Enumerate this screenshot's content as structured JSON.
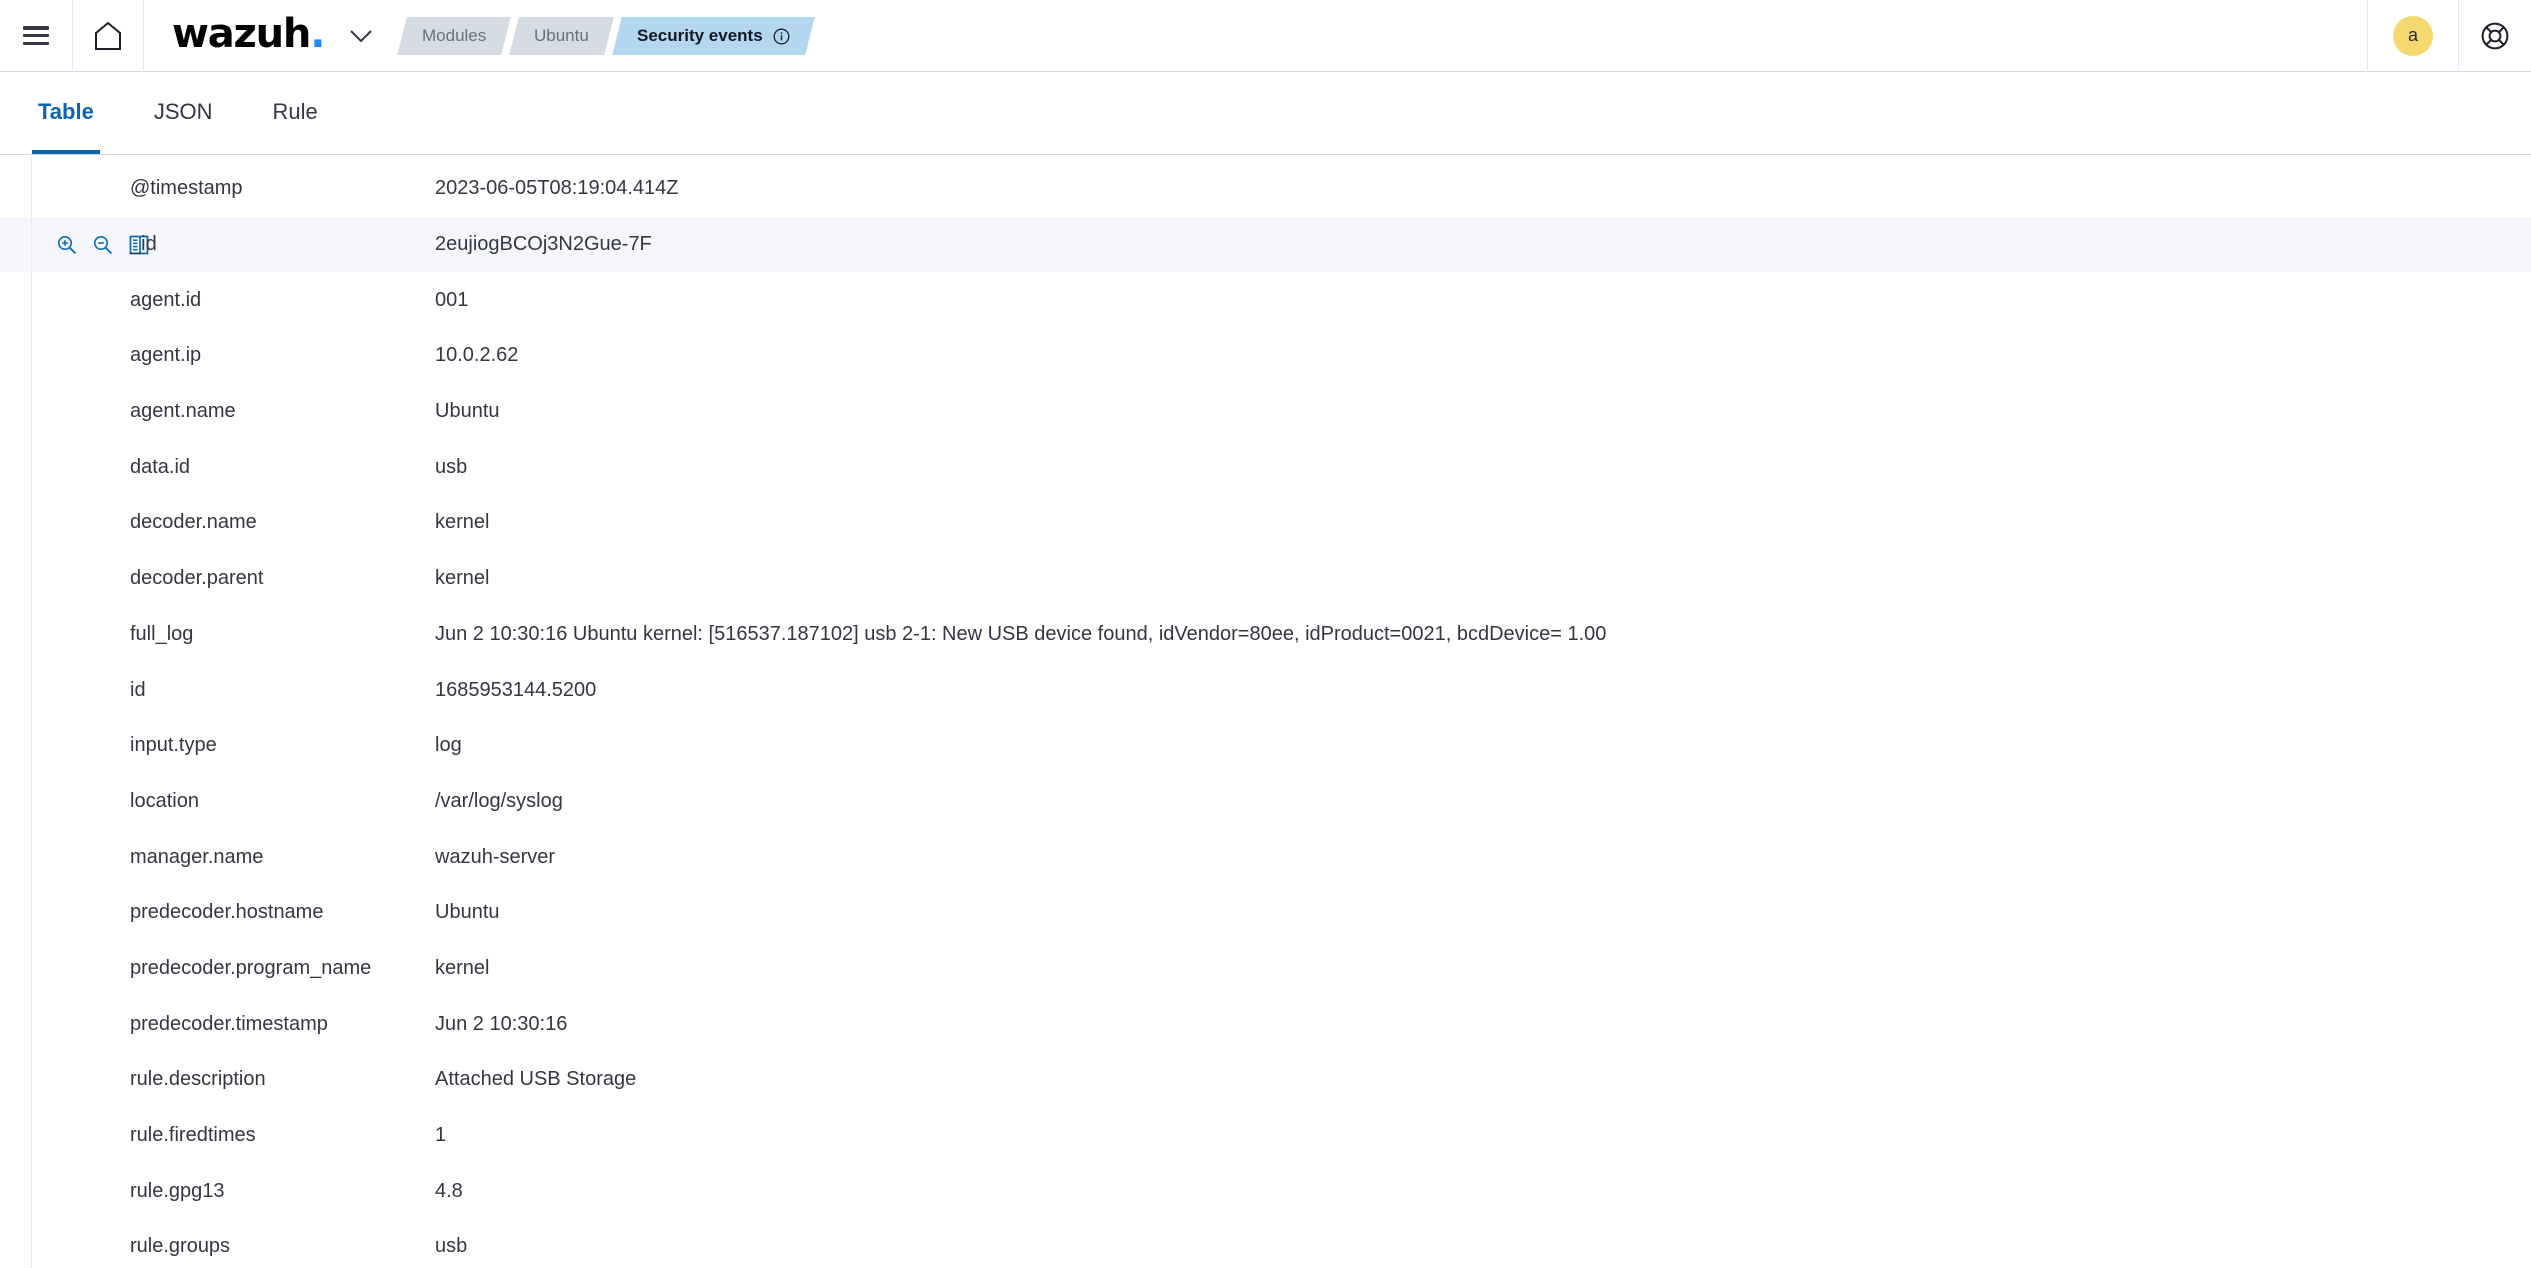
{
  "header": {
    "menu_icon": "hamburger-menu-icon",
    "home_icon": "home-icon",
    "brand_name": "wazuh",
    "brand_dot": ".",
    "brand_dot_color": "#1f8bff",
    "chevron_icon": "chevron-down-icon",
    "breadcrumbs": [
      {
        "label": "Modules",
        "active": false
      },
      {
        "label": "Ubuntu",
        "active": false
      },
      {
        "label": "Security events",
        "active": true,
        "info_icon": "info-circle-icon"
      }
    ],
    "avatar_initial": "a",
    "avatar_color": "#f5d86e",
    "help_icon": "help-lifebuoy-icon"
  },
  "tabs": [
    {
      "label": "Table",
      "active": true
    },
    {
      "label": "JSON",
      "active": false
    },
    {
      "label": "Rule",
      "active": false
    }
  ],
  "accent_color": "#0b64b0",
  "row_actions": {
    "filter_for_value_icon": "magnifier-plus-icon",
    "filter_out_value_icon": "magnifier-minus-icon",
    "toggle_column_icon": "table-column-icon"
  },
  "document_fields": [
    {
      "name": "@timestamp",
      "value": "2023-06-05T08:19:04.414Z",
      "hovered": false
    },
    {
      "name": "_id",
      "value": "2eujiogBCOj3N2Gue-7F",
      "hovered": true
    },
    {
      "name": "agent.id",
      "value": "001",
      "hovered": false
    },
    {
      "name": "agent.ip",
      "value": "10.0.2.62",
      "hovered": false
    },
    {
      "name": "agent.name",
      "value": "Ubuntu",
      "hovered": false
    },
    {
      "name": "data.id",
      "value": "usb",
      "hovered": false
    },
    {
      "name": "decoder.name",
      "value": "kernel",
      "hovered": false
    },
    {
      "name": "decoder.parent",
      "value": "kernel",
      "hovered": false
    },
    {
      "name": "full_log",
      "value": "Jun  2 10:30:16 Ubuntu kernel: [516537.187102] usb 2-1: New USB device found, idVendor=80ee, idProduct=0021, bcdDevice= 1.00",
      "hovered": false
    },
    {
      "name": "id",
      "value": "1685953144.5200",
      "hovered": false
    },
    {
      "name": "input.type",
      "value": "log",
      "hovered": false
    },
    {
      "name": "location",
      "value": "/var/log/syslog",
      "hovered": false
    },
    {
      "name": "manager.name",
      "value": "wazuh-server",
      "hovered": false
    },
    {
      "name": "predecoder.hostname",
      "value": "Ubuntu",
      "hovered": false
    },
    {
      "name": "predecoder.program_name",
      "value": "kernel",
      "hovered": false
    },
    {
      "name": "predecoder.timestamp",
      "value": "Jun  2 10:30:16",
      "hovered": false
    },
    {
      "name": "rule.description",
      "value": "Attached USB Storage",
      "hovered": false
    },
    {
      "name": "rule.firedtimes",
      "value": "1",
      "hovered": false
    },
    {
      "name": "rule.gpg13",
      "value": "4.8",
      "hovered": false
    },
    {
      "name": "rule.groups",
      "value": "usb",
      "hovered": false
    }
  ]
}
